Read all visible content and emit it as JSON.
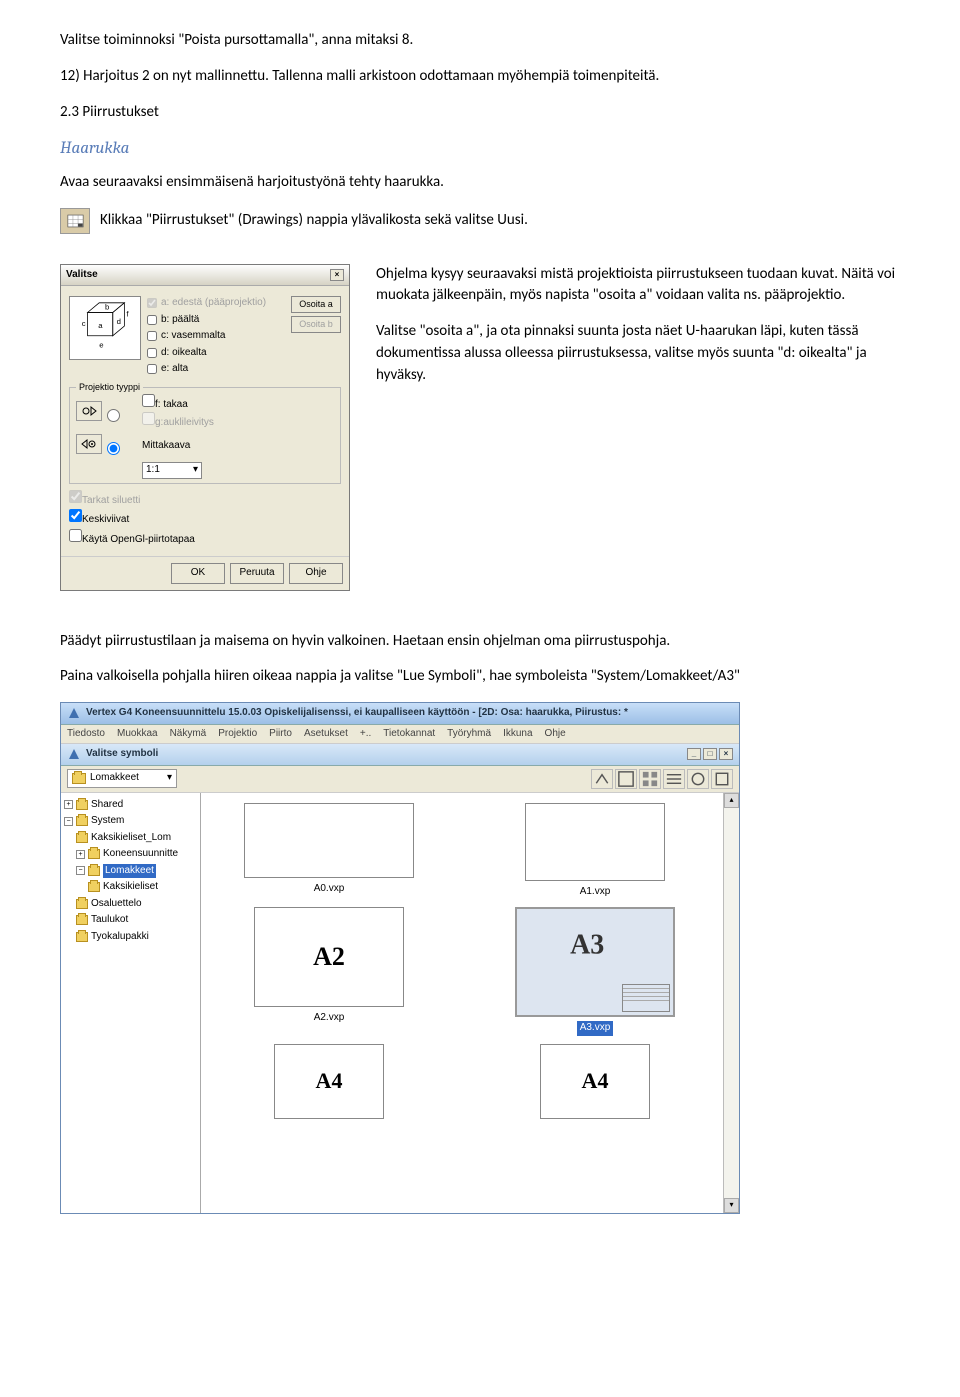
{
  "para1": "Valitse toiminnoksi \"Poista pursottamalla\", anna mitaksi 8.",
  "para2": "12) Harjoitus 2 on nyt mallinnettu. Tallenna malli arkistoon odottamaan myöhempiä toimenpiteitä.",
  "section_number": "2.3 Piirrustukset",
  "heading_haarukka": "Haarukka",
  "para3": "Avaa seuraavaksi ensimmäisenä harjoitustyönä tehty haarukka.",
  "para4": "Klikkaa \"Piirrustukset\" (Drawings) nappia ylävalikosta sekä valitse Uusi.",
  "right1": "Ohjelma kysyy seuraavaksi mistä projektioista piirrustukseen tuodaan kuvat. Näitä voi muokata jälkeenpäin, myös napista \"osoita a\" voidaan valita ns. pääprojektio.",
  "right2": "Valitse \"osoita a\", ja ota pinnaksi suunta josta näet U-haarukan läpi, kuten tässä dokumentissa alussa olleessa piirrustuksessa, valitse myös suunta \"d: oikealta\" ja hyväksy.",
  "para5": "Päädyt piirrustustilaan ja maisema on hyvin valkoinen. Haetaan ensin ohjelman oma piirrustuspohja.",
  "para6": "Paina valkoisella pohjalla hiiren oikeaa nappia ja valitse \"Lue Symboli\", hae symboleista \"System/Lomakkeet/A3\"",
  "dialog1": {
    "title": "Valitse",
    "close": "×",
    "check_a": "a: edestä (pääprojektio)",
    "check_b": "b: päältä",
    "check_c": "c: vasemmalta",
    "check_d": "d: oikealta",
    "check_e": "e: alta",
    "check_f": "f: takaa",
    "check_g": "g:auklileivitys",
    "btn_osoita_a": "Osoita a",
    "btn_osoita_b": "Osoita b",
    "group_proj": "Projektio tyyppi",
    "mittakaava": "Mittakaava",
    "scale": "1:1",
    "tarkat": "Tarkat siluetti",
    "keski": "Keskiviivat",
    "opengl": "Käytä OpenGl-piirtotapaa",
    "ok": "OK",
    "peruuta": "Peruuta",
    "ohje": "Ohje"
  },
  "shot2": {
    "app_title": "Vertex G4 Koneensuunnittelu 15.0.03 Opiskelijalisenssi, ei kaupalliseen käyttöön - [2D: Osa: haarukka, Piirustus: *",
    "menu": [
      "Tiedosto",
      "Muokkaa",
      "Näkymä",
      "Projektio",
      "Piirto",
      "Asetukset",
      "+..",
      "Tietokannat",
      "Työryhmä",
      "Ikkuna",
      "Ohje"
    ],
    "sub_title": "Valitse symboli",
    "dropdown": "Lomakkeet",
    "tree": [
      {
        "lvl": 0,
        "box": "+",
        "label": "Shared"
      },
      {
        "lvl": 0,
        "box": "−",
        "label": "System"
      },
      {
        "lvl": 1,
        "box": "",
        "label": "Kaksikieliset_Lom"
      },
      {
        "lvl": 1,
        "box": "+",
        "label": "Koneensuunnitte"
      },
      {
        "lvl": 1,
        "box": "−",
        "label": "Lomakkeet",
        "selected": true
      },
      {
        "lvl": 2,
        "box": "",
        "label": "Kaksikieliset"
      },
      {
        "lvl": 1,
        "box": "",
        "label": "Osaluettelo"
      },
      {
        "lvl": 1,
        "box": "",
        "label": "Taulukot"
      },
      {
        "lvl": 1,
        "box": "",
        "label": "Tyokalupakki"
      }
    ],
    "thumbs": {
      "a0": "A0.vxp",
      "a1": "A1.vxp",
      "a2_inner": "A2",
      "a2": "A2.vxp",
      "a3_inner": "A3",
      "a3": "A3.vxp",
      "a4_inner": "A4",
      "a4b_inner": "A4"
    }
  }
}
